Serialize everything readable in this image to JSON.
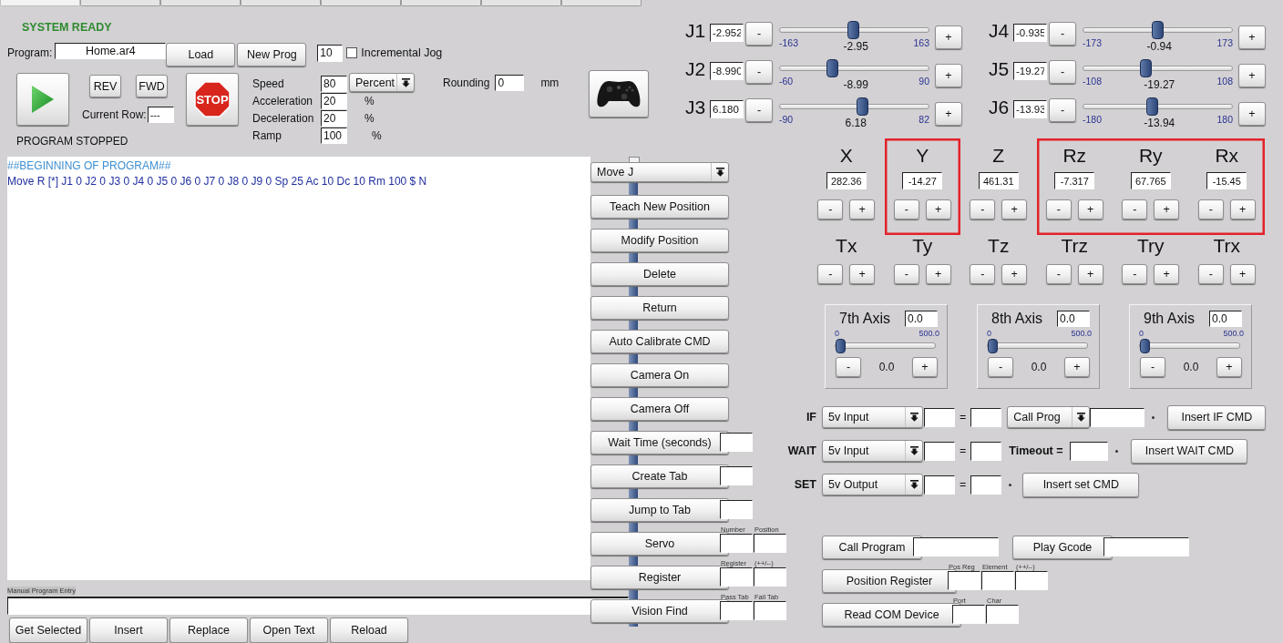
{
  "tabs": [
    {
      "selected": true
    },
    {
      "selected": false
    },
    {
      "selected": false
    },
    {
      "selected": false
    },
    {
      "selected": false
    },
    {
      "selected": false
    },
    {
      "selected": false
    },
    {
      "selected": false
    }
  ],
  "status": "SYSTEM READY",
  "program": {
    "label": "Program:",
    "value": "Home.ar4",
    "load": "Load",
    "new": "New Prog"
  },
  "incremental": {
    "value": "10",
    "label": "Incremental Jog",
    "checked": false
  },
  "run": {
    "rev": "REV",
    "fwd": "FWD",
    "stop": "STOP",
    "current_row_label": "Current Row:",
    "current_row": "---",
    "state": "PROGRAM STOPPED"
  },
  "motion": [
    {
      "label": "Speed",
      "value": "80",
      "kind": "dropdown",
      "unit": "Percent"
    },
    {
      "label": "Acceleration",
      "value": "20",
      "kind": "unit",
      "unit": "%"
    },
    {
      "label": "Deceleration",
      "value": "20",
      "kind": "unit",
      "unit": "%"
    },
    {
      "label": "Ramp",
      "value": "100",
      "kind": "unit",
      "unit": "%"
    }
  ],
  "rounding": {
    "label": "Rounding",
    "value": "0",
    "unit": "mm"
  },
  "program_lines": [
    {
      "text": "##BEGINNING OF PROGRAM##",
      "kind": "comment"
    },
    {
      "text": "Move R [*] J1 0 J2 0 J3 0 J4 0 J5 0 J6 0 J7 0 J8 0 J9 0 Sp 25 Ac 10 Dc 10 Rm 100 $ N",
      "kind": "command"
    }
  ],
  "manual_entry": {
    "label": "Manual Program Entry"
  },
  "bottom_buttons": [
    "Get Selected",
    "Insert",
    "Replace",
    "Open Text",
    "Reload"
  ],
  "command_type": "Move J",
  "commands": [
    {
      "label": "Teach New Position"
    },
    {
      "label": "Modify Position"
    },
    {
      "label": "Delete"
    },
    {
      "label": "Return"
    },
    {
      "label": "Auto Calibrate CMD"
    },
    {
      "label": "Camera On"
    },
    {
      "label": "Camera Off"
    },
    {
      "label": "Wait Time (seconds)",
      "fields": [
        {
          "kind": "small"
        }
      ]
    },
    {
      "label": "Create Tab",
      "fields": [
        {
          "kind": "small"
        }
      ]
    },
    {
      "label": "Jump to Tab",
      "fields": [
        {
          "kind": "small"
        }
      ]
    },
    {
      "label": "Servo",
      "fields": [
        {
          "kind": "small",
          "caption": "Number"
        },
        {
          "kind": "small",
          "caption": "Position"
        }
      ]
    },
    {
      "label": "Register",
      "fields": [
        {
          "kind": "small",
          "caption": "Register"
        },
        {
          "kind": "small",
          "caption": "(++/--)"
        }
      ]
    },
    {
      "label": "Vision Find",
      "fields": [
        {
          "kind": "small",
          "caption": "Pass Tab"
        },
        {
          "kind": "small",
          "caption": "Fail Tab"
        }
      ]
    }
  ],
  "joints": [
    {
      "name": "J1",
      "value": "-2.952",
      "min": "-163",
      "max": "163",
      "reading": "-2.95",
      "level": 0.491,
      "dec": "-",
      "inc": "+"
    },
    {
      "name": "J4",
      "value": "-0.935",
      "min": "-173",
      "max": "173",
      "reading": "-0.94",
      "level": 0.497,
      "dec": "-",
      "inc": "+"
    },
    {
      "name": "J2",
      "value": "-8.990",
      "min": "-60",
      "max": "90",
      "reading": "-8.99",
      "level": 0.34,
      "dec": "-",
      "inc": "+"
    },
    {
      "name": "J5",
      "value": "-19.27",
      "min": "-108",
      "max": "108",
      "reading": "-19.27",
      "level": 0.411,
      "dec": "-",
      "inc": "+"
    },
    {
      "name": "J3",
      "value": "6.180",
      "min": "-90",
      "max": "82",
      "reading": "6.18",
      "level": 0.559,
      "dec": "-",
      "inc": "+"
    },
    {
      "name": "J6",
      "value": "-13.93",
      "min": "-180",
      "max": "180",
      "reading": "-13.94",
      "level": 0.461,
      "dec": "-",
      "inc": "+"
    }
  ],
  "cartesian": [
    {
      "name": "X",
      "value": "282.36",
      "highlighted": false,
      "dec": "-",
      "inc": "+"
    },
    {
      "name": "Y",
      "value": "-14.27",
      "highlighted": true,
      "dec": "-",
      "inc": "+"
    },
    {
      "name": "Z",
      "value": "461.31",
      "highlighted": false,
      "dec": "-",
      "inc": "+"
    },
    {
      "name": "Rz",
      "value": "-7.317",
      "highlighted": true,
      "dec": "-",
      "inc": "+"
    },
    {
      "name": "Ry",
      "value": "67.765",
      "highlighted": true,
      "dec": "-",
      "inc": "+"
    },
    {
      "name": "Rx",
      "value": "-15.45",
      "highlighted": true,
      "dec": "-",
      "inc": "+"
    }
  ],
  "tool": [
    {
      "name": "Tx",
      "dec": "-",
      "inc": "+"
    },
    {
      "name": "Ty",
      "dec": "-",
      "inc": "+"
    },
    {
      "name": "Tz",
      "dec": "-",
      "inc": "+"
    },
    {
      "name": "Trz",
      "dec": "-",
      "inc": "+"
    },
    {
      "name": "Try",
      "dec": "-",
      "inc": "+"
    },
    {
      "name": "Trx",
      "dec": "-",
      "inc": "+"
    }
  ],
  "aux_axes": [
    {
      "name": "7th Axis",
      "value": "0.0",
      "min": "0",
      "max": "500.0",
      "reading": "0.0",
      "level": 0,
      "dec": "-",
      "inc": "+"
    },
    {
      "name": "8th Axis",
      "value": "0.0",
      "min": "0",
      "max": "500.0",
      "reading": "0.0",
      "level": 0,
      "dec": "-",
      "inc": "+"
    },
    {
      "name": "9th Axis",
      "value": "0.0",
      "min": "0",
      "max": "500.0",
      "reading": "0.0",
      "level": 0,
      "dec": "-",
      "inc": "+"
    }
  ],
  "io_rows": [
    {
      "kind": "if",
      "label": "IF",
      "source": "5v Input",
      "equals": "=",
      "action": "Call Prog",
      "button": "Insert IF CMD"
    },
    {
      "kind": "wait",
      "label": "WAIT",
      "source": "5v Input",
      "equals": "=",
      "timeout_label": "Timeout =",
      "button": "Insert WAIT CMD"
    },
    {
      "kind": "set",
      "label": "SET",
      "source": "5v Output",
      "equals": "=",
      "button": "Insert set CMD"
    }
  ],
  "extra_rows": [
    [
      {
        "label": "Call Program",
        "fields": [
          {
            "kind": "wide"
          }
        ]
      },
      {
        "label": "Play Gcode",
        "fields": [
          {
            "kind": "wide"
          }
        ]
      }
    ],
    [
      {
        "label": "Position Register",
        "fields": [
          {
            "kind": "small",
            "caption": "Pos Reg"
          },
          {
            "kind": "small",
            "caption": "Element"
          },
          {
            "kind": "small",
            "caption": "(++/--)"
          }
        ]
      }
    ],
    [
      {
        "label": "Read COM Device",
        "fields": [
          {
            "kind": "small",
            "caption": "Port"
          },
          {
            "kind": "small",
            "caption": "Char"
          }
        ]
      }
    ]
  ]
}
